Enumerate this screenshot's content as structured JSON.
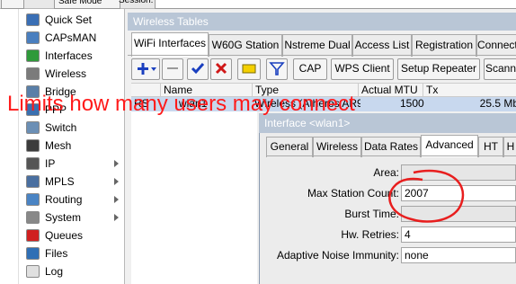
{
  "topbar": {
    "btn1": "",
    "btn2": "Safe Mode",
    "session": "Session:"
  },
  "sidebar": {
    "items": [
      {
        "label": "Quick Set",
        "icon": "quick-set-icon",
        "color": "#3a6fb5",
        "arrow": false
      },
      {
        "label": "CAPsMAN",
        "icon": "capsman-icon",
        "color": "#4a7fbf",
        "arrow": false
      },
      {
        "label": "Interfaces",
        "icon": "interfaces-icon",
        "color": "#2f9a3a",
        "arrow": false
      },
      {
        "label": "Wireless",
        "icon": "wireless-icon",
        "color": "#7b7b7b",
        "arrow": false
      },
      {
        "label": "Bridge",
        "icon": "bridge-icon",
        "color": "#5a7fa8",
        "arrow": false
      },
      {
        "label": "PPP",
        "icon": "ppp-icon",
        "color": "#3a70b0",
        "arrow": false
      },
      {
        "label": "Switch",
        "icon": "switch-icon",
        "color": "#6b8fb5",
        "arrow": false
      },
      {
        "label": "Mesh",
        "icon": "mesh-icon",
        "color": "#3c3c3c",
        "arrow": false
      },
      {
        "label": "IP",
        "icon": "ip-icon",
        "color": "#555555",
        "arrow": true
      },
      {
        "label": "MPLS",
        "icon": "mpls-icon",
        "color": "#4a6fa0",
        "arrow": true
      },
      {
        "label": "Routing",
        "icon": "routing-icon",
        "color": "#4a84c4",
        "arrow": true
      },
      {
        "label": "System",
        "icon": "system-icon",
        "color": "#888888",
        "arrow": true
      },
      {
        "label": "Queues",
        "icon": "queues-icon",
        "color": "#d02020",
        "arrow": false
      },
      {
        "label": "Files",
        "icon": "files-icon",
        "color": "#2f6fb5",
        "arrow": false
      },
      {
        "label": "Log",
        "icon": "log-icon",
        "color": "#e0e0e0",
        "arrow": false
      }
    ]
  },
  "window": {
    "title": "Wireless Tables",
    "tabs": [
      "WiFi Interfaces",
      "W60G Station",
      "Nstreme Dual",
      "Access List",
      "Registration",
      "Connect"
    ],
    "toolbar": {
      "cap": "CAP",
      "wps": "WPS Client",
      "setup": "Setup Repeater",
      "scan": "Scann"
    },
    "columns": [
      "Name",
      "Type",
      "Actual MTU",
      "Tx"
    ],
    "row": {
      "flag": "RS",
      "name": "wlan1",
      "type": "Wireless (Atheros AR9",
      "mtu": "1500",
      "tx": "25.5 Mb"
    }
  },
  "dialog": {
    "title": "Interface <wlan1>",
    "tabs": [
      "General",
      "Wireless",
      "Data Rates",
      "Advanced",
      "HT",
      "H"
    ],
    "active_tab": "Advanced",
    "fields": {
      "area_label": "Area:",
      "area_value": "",
      "max_station_label": "Max Station Count:",
      "max_station_value": "2007",
      "burst_label": "Burst Time:",
      "burst_value": "",
      "retries_label": "Hw. Retries:",
      "retries_value": "4",
      "noise_label": "Adaptive Noise Immunity:",
      "noise_value": "none"
    }
  },
  "annotation": {
    "text": "Limits how many users may connect",
    "color": "#ff1a1a"
  }
}
